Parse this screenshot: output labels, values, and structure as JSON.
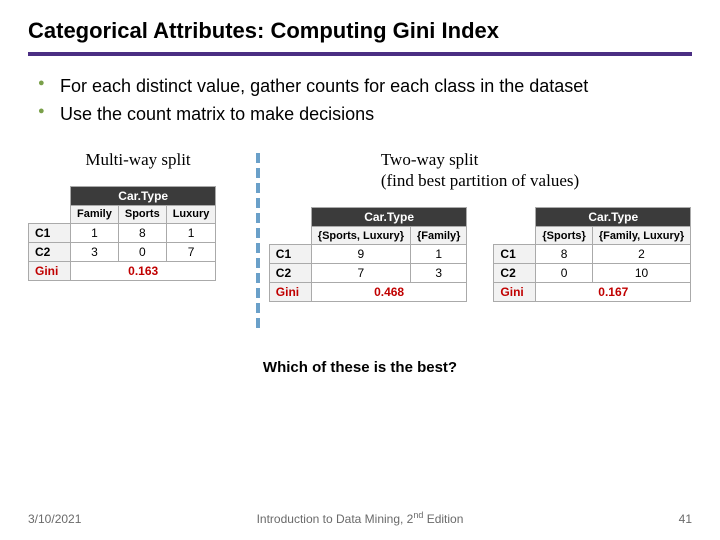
{
  "title": "Categorical Attributes: Computing Gini Index",
  "bullets": [
    "For each distinct value, gather counts for each class in the dataset",
    "Use the count matrix to make decisions"
  ],
  "multiway": {
    "heading": "Multi-way split",
    "attribute": "Car.Type",
    "columns": [
      "Family",
      "Sports",
      "Luxury"
    ],
    "rows": [
      {
        "label": "C1",
        "values": [
          "1",
          "8",
          "1"
        ]
      },
      {
        "label": "C2",
        "values": [
          "3",
          "0",
          "7"
        ]
      }
    ],
    "gini_label": "Gini",
    "gini_value": "0.163"
  },
  "twoway": {
    "heading": "Two-way split",
    "subheading": "(find best partition of values)",
    "tables": [
      {
        "attribute": "Car.Type",
        "columns": [
          "{Sports, Luxury}",
          "{Family}"
        ],
        "rows": [
          {
            "label": "C1",
            "values": [
              "9",
              "1"
            ]
          },
          {
            "label": "C2",
            "values": [
              "7",
              "3"
            ]
          }
        ],
        "gini_label": "Gini",
        "gini_value": "0.468"
      },
      {
        "attribute": "Car.Type",
        "columns": [
          "{Sports}",
          "{Family, Luxury}"
        ],
        "rows": [
          {
            "label": "C1",
            "values": [
              "8",
              "2"
            ]
          },
          {
            "label": "C2",
            "values": [
              "0",
              "10"
            ]
          }
        ],
        "gini_label": "Gini",
        "gini_value": "0.167"
      }
    ]
  },
  "question": "Which of these is the best?",
  "footer": {
    "date": "3/10/2021",
    "center_pre": "Introduction to Data Mining, 2",
    "center_sup": "nd",
    "center_post": " Edition",
    "page": "41"
  }
}
